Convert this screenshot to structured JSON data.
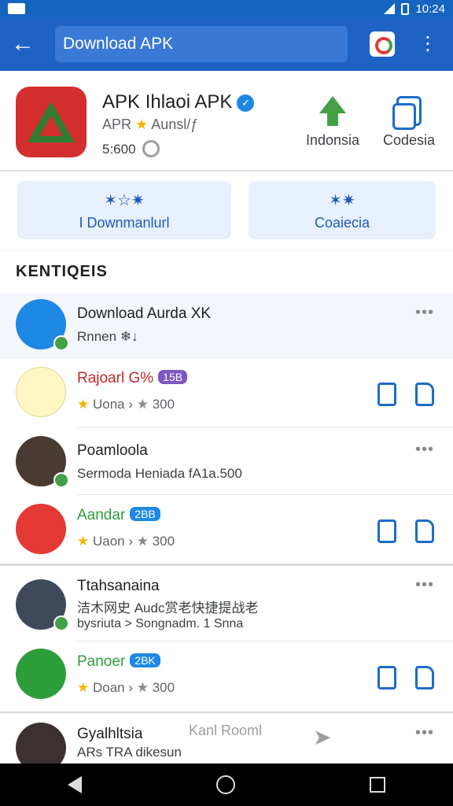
{
  "status_bar": {
    "time": "10:24"
  },
  "app_bar": {
    "back_icon": "arrow-left-icon",
    "search_text": "Download APK",
    "menu_icon": "more-vert-icon"
  },
  "hero": {
    "title": "APK Ihlaoi APK",
    "subtitle_prefix": "APR",
    "subtitle_suffix": "Aunsl/ƒ",
    "size": "5:600",
    "actions": [
      {
        "label": "Indonsia",
        "icon": "upload-arrow-icon",
        "color": "#43a047"
      },
      {
        "label": "Codesia",
        "icon": "copy-icon",
        "color": "#1e6cc8"
      }
    ]
  },
  "pills": [
    {
      "stars": "✶☆✷",
      "label": "I Downmanlurl"
    },
    {
      "stars": "✶✷",
      "label": "Coaiecia"
    }
  ],
  "section_title": "KENTIQEIS",
  "items": [
    {
      "title": "Download Aurda XK",
      "subtitle": "Rnnen ❄↓",
      "avatar_color": "#1e88e5",
      "dots": "•••"
    },
    {
      "title": "Rajoarl G%",
      "tag": "15B",
      "rating_a": "Uona",
      "rating_b": "300",
      "avatar_color": "#fff6c4"
    },
    {
      "title": "Poamloola",
      "subtitle": "Sermoda Heniada fA1a.500",
      "avatar_color": "#4a3b32",
      "dots": "•••"
    },
    {
      "title": "Aandar",
      "tag": "2BB",
      "rating_a": "Uaon",
      "rating_b": "300",
      "avatar_color": "#e53935"
    },
    {
      "title": "Ttahsanaina",
      "subtitle": "洁木网史 Audc赏老快捷提战老",
      "subtitle2": "bysriuta > Songnadm. 1 Snna",
      "avatar_color": "#3e4a5a",
      "dots": "•••"
    },
    {
      "title": "Panoer",
      "tag": "2BK",
      "rating_a": "Doan",
      "rating_b": "300",
      "avatar_color": "#2e9e3a"
    },
    {
      "title": "Gyalhltsia",
      "subtitle": "ARs TRA dikesun",
      "avatar_color": "#3c3030",
      "dots": "•••"
    }
  ],
  "bottom_overlay": {
    "label": "Kanl Rooml"
  }
}
